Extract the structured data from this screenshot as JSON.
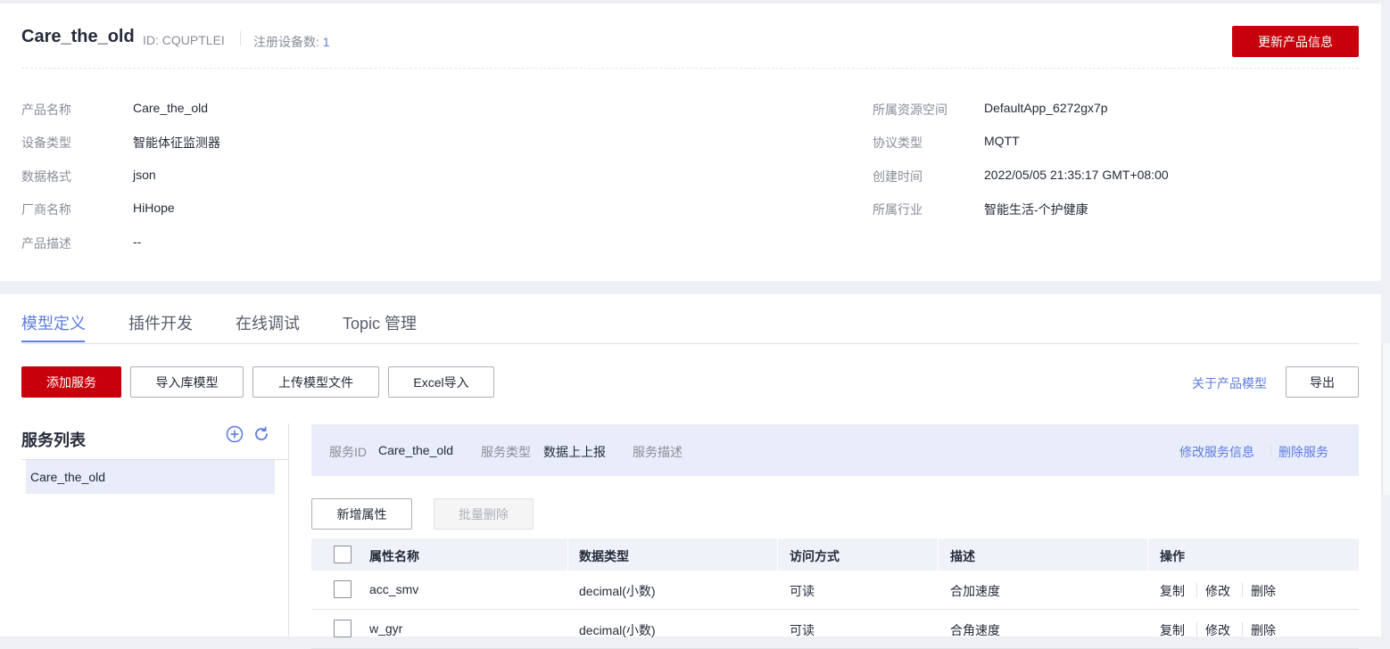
{
  "product": {
    "name": "Care_the_old",
    "id_text": "ID: CQUPTLEI",
    "registered_label": "注册设备数:",
    "registered_count": "1",
    "update_button": "更新产品信息"
  },
  "info_left": [
    {
      "label": "产品名称",
      "value": "Care_the_old"
    },
    {
      "label": "设备类型",
      "value": "智能体征监测器"
    },
    {
      "label": "数据格式",
      "value": "json"
    },
    {
      "label": "厂商名称",
      "value": "HiHope"
    },
    {
      "label": "产品描述",
      "value": "--"
    }
  ],
  "info_right": [
    {
      "label": "所属资源空间",
      "value": "DefaultApp_6272gx7p"
    },
    {
      "label": "协议类型",
      "value": "MQTT"
    },
    {
      "label": "创建时间",
      "value": "2022/05/05 21:35:17 GMT+08:00"
    },
    {
      "label": "所属行业",
      "value": "智能生活-个护健康"
    }
  ],
  "tabs": [
    "模型定义",
    "插件开发",
    "在线调试",
    "Topic 管理"
  ],
  "toolbar": {
    "add_service": "添加服务",
    "import_lib": "导入库模型",
    "upload_model": "上传模型文件",
    "excel_import": "Excel导入",
    "about_model": "关于产品模型",
    "export": "导出"
  },
  "service_list": {
    "title": "服务列表",
    "items": [
      "Care_the_old"
    ]
  },
  "service_bar": {
    "id_label": "服务ID",
    "id_value": "Care_the_old",
    "type_label": "服务类型",
    "type_value": "数据上上报",
    "desc_label": "服务描述",
    "edit_link": "修改服务信息",
    "delete_link": "删除服务"
  },
  "property_actions": {
    "add": "新增属性",
    "batch_delete": "批量删除"
  },
  "table": {
    "headers": [
      "属性名称",
      "数据类型",
      "访问方式",
      "描述",
      "操作"
    ],
    "rows": [
      {
        "name": "acc_smv",
        "type": "decimal(小数)",
        "access": "可读",
        "desc": "合加速度"
      },
      {
        "name": "w_gyr",
        "type": "decimal(小数)",
        "access": "可读",
        "desc": "合角速度"
      }
    ],
    "ops": [
      "复制",
      "修改",
      "删除"
    ]
  },
  "colors": {
    "primary_red": "#c7000b",
    "link_blue": "#5e7ce0",
    "bar_bg": "#e9edfa"
  }
}
